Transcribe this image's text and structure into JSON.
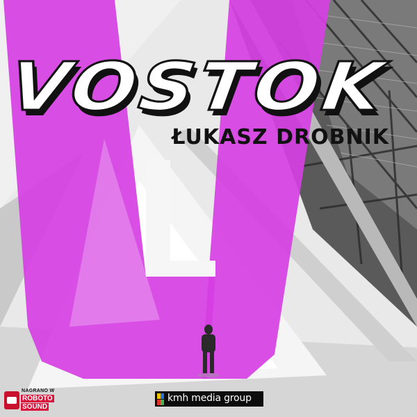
{
  "cover": {
    "title": "VOSTOK",
    "author": "ŁUKASZ DROBNIK",
    "colors": {
      "accent_magenta": "#d63fe3",
      "title_fill": "#ffffff",
      "title_outline": "#111111",
      "background_light": "#ececec",
      "background_dark": "#3a3a3a"
    }
  },
  "badge": {
    "line1": "NAGRANO W",
    "line2": "ROBOTO",
    "line3": "SOUND",
    "icon": "robot-icon",
    "color": "#d8123a"
  },
  "publisher": {
    "name": "kmh media group",
    "logo_colors": [
      "#f2c200",
      "#2a6fd1",
      "#e0342a",
      "#4caf50"
    ]
  }
}
